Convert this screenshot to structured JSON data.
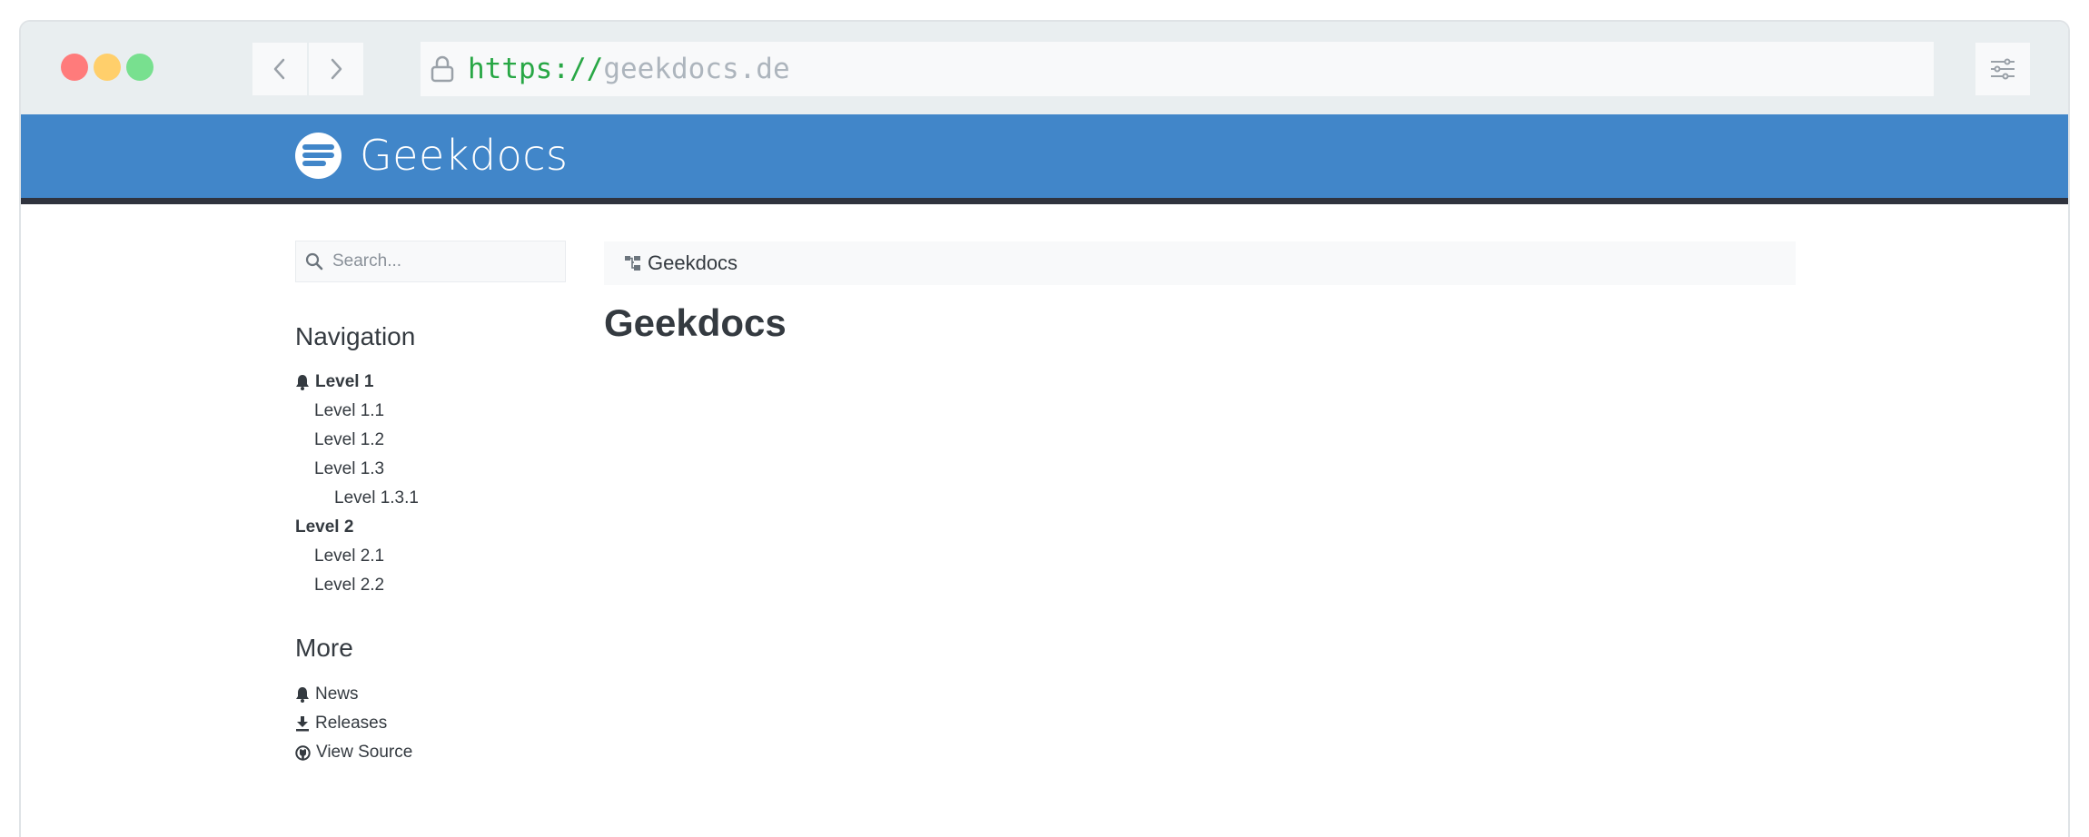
{
  "browser": {
    "url_scheme": "https://",
    "url_host": "geekdocs.de"
  },
  "site": {
    "title": "Geekdocs"
  },
  "search": {
    "placeholder": "Search..."
  },
  "navigation": {
    "heading": "Navigation",
    "items": [
      {
        "label": "Level 1"
      },
      {
        "label": "Level 1.1"
      },
      {
        "label": "Level 1.2"
      },
      {
        "label": "Level 1.3"
      },
      {
        "label": "Level 1.3.1"
      },
      {
        "label": "Level 2"
      },
      {
        "label": "Level 2.1"
      },
      {
        "label": "Level 2.2"
      }
    ]
  },
  "more": {
    "heading": "More",
    "items": [
      {
        "label": "News",
        "icon": "bell-icon"
      },
      {
        "label": "Releases",
        "icon": "download-icon"
      },
      {
        "label": "View Source",
        "icon": "github-icon"
      }
    ]
  },
  "breadcrumb": {
    "label": "Geekdocs",
    "icon": "sitemap-icon"
  },
  "main": {
    "title": "Geekdocs"
  },
  "colors": {
    "header_blue": "#4186c9",
    "header_border": "#2f333e",
    "url_scheme_green": "#28a745",
    "dot_red": "#ff7b7b",
    "dot_yellow": "#ffcf6b",
    "dot_green": "#78e08f"
  }
}
